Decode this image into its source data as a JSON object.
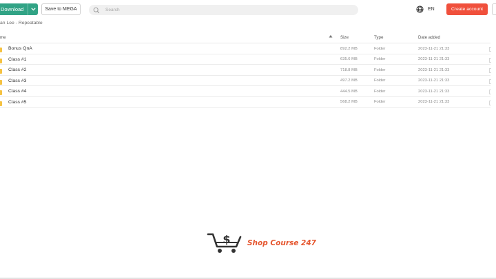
{
  "toolbar": {
    "download_label": "Download",
    "save_label": "Save to MEGA",
    "search_placeholder": "Search",
    "language": "EN",
    "create_account_label": "Create account"
  },
  "breadcrumb": "an Lee - Repeatable",
  "table": {
    "headers": {
      "name": "me",
      "size": "Size",
      "type": "Type",
      "date": "Date added"
    },
    "rows": [
      {
        "name": "Bonus QnA",
        "size": "892.2 MB",
        "type": "Folder",
        "date": "2023-11-21 21:33"
      },
      {
        "name": "Class #1",
        "size": "635.6 MB",
        "type": "Folder",
        "date": "2023-11-21 21:33"
      },
      {
        "name": "Class #2",
        "size": "718.8 MB",
        "type": "Folder",
        "date": "2023-11-21 21:33"
      },
      {
        "name": "Class #3",
        "size": "497.2 MB",
        "type": "Folder",
        "date": "2023-11-21 21:33"
      },
      {
        "name": "Class #4",
        "size": "444.5 MB",
        "type": "Folder",
        "date": "2023-11-21 21:33"
      },
      {
        "name": "Class #5",
        "size": "568.2 MB",
        "type": "Folder",
        "date": "2023-11-21 21:33"
      }
    ]
  },
  "watermark": {
    "text": "Shop Course 247"
  },
  "colors": {
    "download": "#31a385",
    "create": "#f0503c",
    "folder": "#f5c242",
    "logo": "#e5562f"
  },
  "icons": {
    "search": "search-icon",
    "language": "globe-icon",
    "dropdown": "chevron-down-icon",
    "sort": "sort-up-icon",
    "folder": "folder-icon",
    "logo": "cart-dollar-icon"
  }
}
